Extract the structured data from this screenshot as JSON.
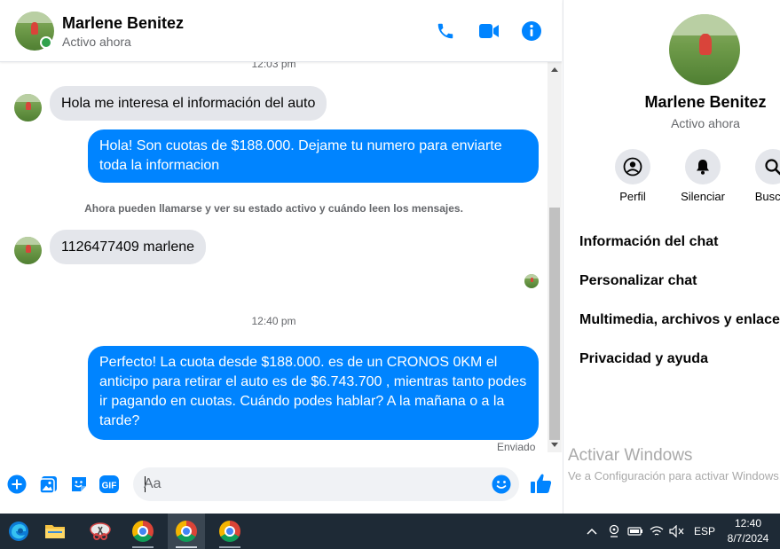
{
  "contact": {
    "name": "Marlene Benitez",
    "status": "Activo ahora"
  },
  "messages": {
    "time_top": "12:03 pm",
    "in_1": "Hola me interesa el información del auto",
    "out_1": "Hola! Son cuotas de $188.000. Dejame tu numero para enviarte toda la informacion",
    "system_notice": "Ahora pueden llamarse y ver su estado activo y cuándo leen los mensajes.",
    "in_2": "1126477409 marlene",
    "time_mid": "12:40 pm",
    "out_2": "Perfecto! La cuota desde $188.000. es de un CRONOS 0KM el anticipo para retirar el auto es de $6.743.700 , mientras tanto podes ir pagando en cuotas. Cuándo podes hablar? A la mañana o a la tarde?",
    "sent_label": "Enviado"
  },
  "composer": {
    "placeholder": "Aa",
    "gif_label": "GIF"
  },
  "info_panel": {
    "actions": [
      {
        "label": "Perfil"
      },
      {
        "label": "Silenciar"
      },
      {
        "label": "Buscar"
      }
    ],
    "menu": [
      {
        "label": "Información del chat"
      },
      {
        "label": "Personalizar chat"
      },
      {
        "label": "Multimedia, archivos y enlaces"
      },
      {
        "label": "Privacidad y ayuda"
      }
    ]
  },
  "watermark": {
    "title": "Activar Windows",
    "subtitle": "Ve a Configuración para activar Windows."
  },
  "taskbar": {
    "language": "ESP",
    "time": "12:40",
    "date": "8/7/2024"
  },
  "colors": {
    "accent": "#0084ff",
    "online": "#31a24c",
    "bubble_in": "#e4e6eb"
  }
}
